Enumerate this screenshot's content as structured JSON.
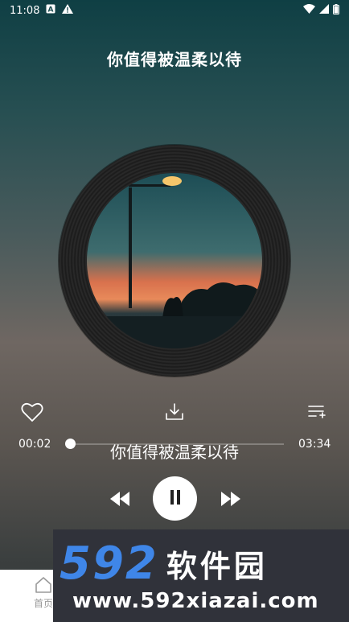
{
  "status_bar": {
    "time": "11:08",
    "left_icons": [
      "a-notification-icon",
      "warning-icon"
    ],
    "right_icons": [
      "wifi-icon",
      "signal-icon",
      "battery-icon"
    ]
  },
  "player": {
    "title": "你值得被温柔以待",
    "lyric": "你值得被温柔以待",
    "current_time": "00:02",
    "total_time": "03:34",
    "progress_fraction": 0.01
  },
  "actions": {
    "like_icon": "heart-icon",
    "download_icon": "download-icon",
    "playlist_icon": "add-to-playlist-icon"
  },
  "playback": {
    "prev_icon": "rewind-icon",
    "pause_icon": "pause-icon",
    "next_icon": "fast-forward-icon"
  },
  "bottom_nav": {
    "home_label": "首页"
  },
  "watermark": {
    "number": "592",
    "name": "软件园",
    "url": "www.592xiazai.com"
  },
  "colors": {
    "accent_blue": "#3f86e8",
    "watermark_bg": "#30323a"
  }
}
